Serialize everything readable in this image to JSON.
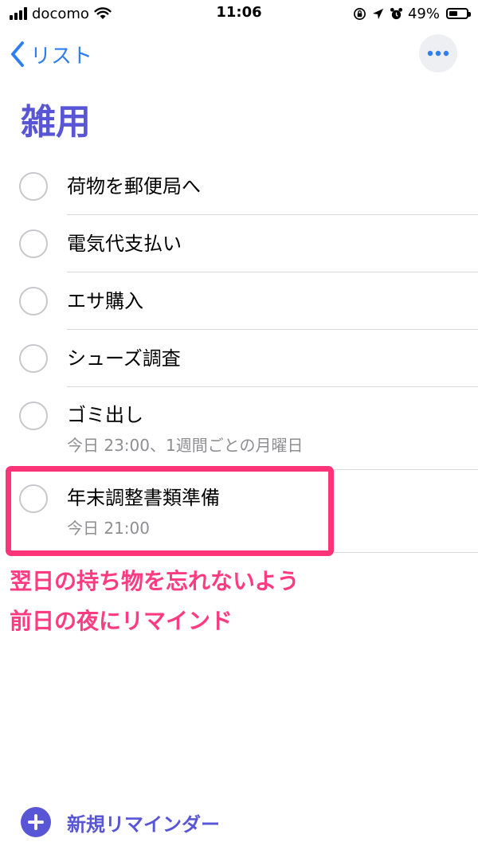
{
  "status_bar": {
    "carrier": "docomo",
    "time": "11:06",
    "battery_percent": "49%",
    "battery_level": 0.49,
    "icons": [
      "signal-icon",
      "wifi-icon",
      "orientation-lock-icon",
      "location-arrow-icon",
      "alarm-icon",
      "battery-icon"
    ]
  },
  "nav": {
    "back_label": "リスト",
    "more_icon": "ellipsis-icon"
  },
  "list": {
    "title": "雑用",
    "title_color": "#5956d6",
    "items": [
      {
        "title": "荷物を郵便局へ",
        "subtitle": ""
      },
      {
        "title": "電気代支払い",
        "subtitle": ""
      },
      {
        "title": "エサ購入",
        "subtitle": ""
      },
      {
        "title": "シューズ調査",
        "subtitle": ""
      },
      {
        "title": "ゴミ出し",
        "subtitle": "今日 23:00、1週間ごとの月曜日"
      },
      {
        "title": "年末調整書類準備",
        "subtitle": "今日 21:00"
      }
    ]
  },
  "annotation": {
    "line1": "翌日の持ち物を忘れないよう",
    "line2": "前日の夜にリマインド",
    "color": "#ff3377"
  },
  "footer": {
    "new_reminder_label": "新規リマインダー"
  },
  "colors": {
    "accent_blue": "#2f7ff0",
    "accent_purple": "#5956d6",
    "checkbox_gray": "#c7c7cc",
    "subtitle_gray": "#8e8e93"
  }
}
